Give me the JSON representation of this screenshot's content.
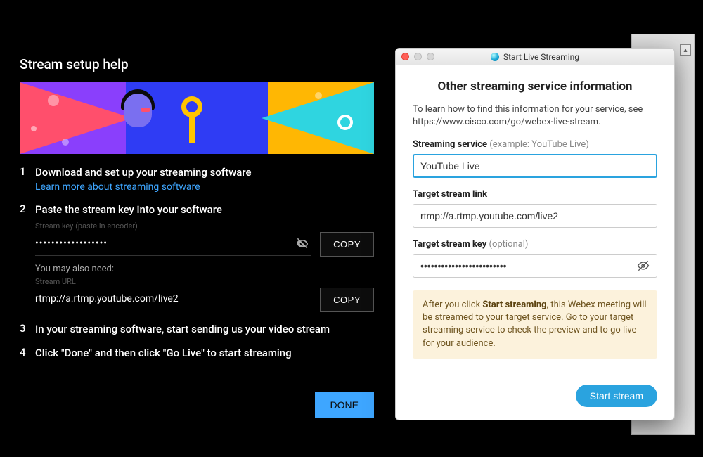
{
  "left": {
    "title": "Stream setup help",
    "steps": [
      {
        "title": "Download and set up your streaming software",
        "link": "Learn more about streaming software"
      },
      {
        "title": "Paste the stream key into your software"
      },
      {
        "title": "In your streaming software, start sending us your video stream"
      },
      {
        "title": "Click \"Done\" and then click \"Go Live\" to start streaming"
      }
    ],
    "stream_key_label": "Stream key (paste in encoder)",
    "stream_key_masked": "••••••••••••••••••",
    "also_need": "You may also need:",
    "stream_url_label": "Stream URL",
    "stream_url": "rtmp://a.rtmp.youtube.com/live2",
    "copy": "COPY",
    "done": "DONE"
  },
  "right": {
    "window_title": "Start Live Streaming",
    "heading": "Other streaming service information",
    "lede": "To learn how to find this information for your service, see https://www.cisco.com/go/webex-live-stream.",
    "service_label": "Streaming service",
    "service_hint": "(example: YouTube Live)",
    "service_value": "YouTube Live",
    "link_label": "Target stream link",
    "link_value": "rtmp://a.rtmp.youtube.com/live2",
    "key_label": "Target stream key",
    "key_hint": "(optional)",
    "key_masked": "•••••••••••••••••••••••••",
    "notice_prefix": "After you click ",
    "notice_bold": "Start streaming",
    "notice_suffix": ", this Webex meeting will be streamed to your target service. Go to your target streaming service to check the preview and to go live for your audience.",
    "start": "Start stream"
  }
}
